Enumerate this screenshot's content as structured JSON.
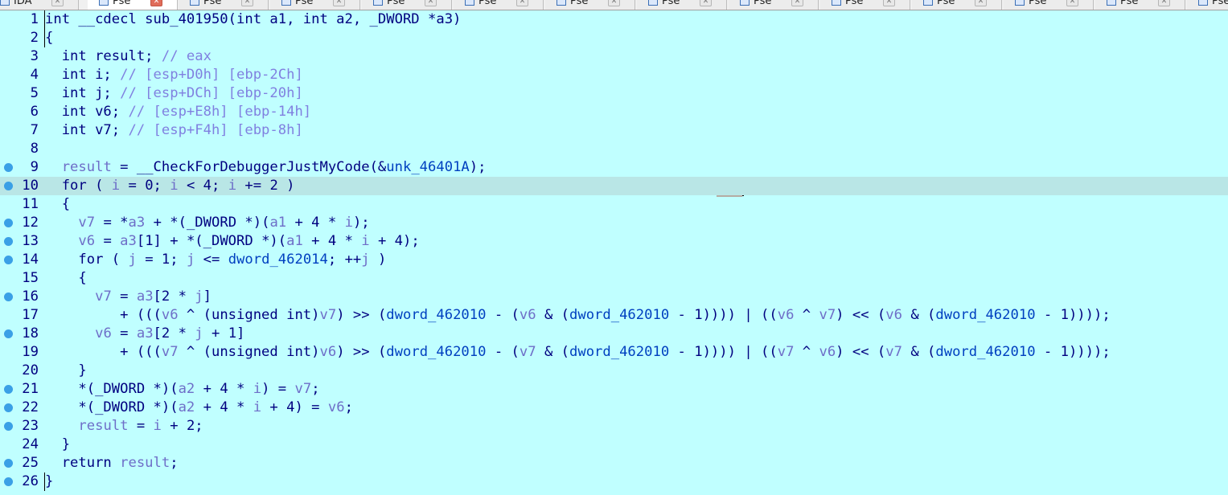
{
  "tabs": [
    {
      "label": "IDA"
    },
    {
      "label": "Pse"
    },
    {
      "label": "Pse"
    },
    {
      "label": "Pse"
    },
    {
      "label": "Pse"
    },
    {
      "label": "Pse"
    },
    {
      "label": "Pse"
    },
    {
      "label": "Pse"
    },
    {
      "label": "Pse"
    },
    {
      "label": "Pse"
    },
    {
      "label": "Pse"
    },
    {
      "label": "Pse"
    },
    {
      "label": "Pse"
    },
    {
      "label": "Pse"
    }
  ],
  "active_tab_index": 1,
  "code": {
    "lines": [
      {
        "n": "1",
        "t": "int __cdecl sub_401950(int a1, int a2, _DWORD *a3)"
      },
      {
        "n": "2",
        "t": "{"
      },
      {
        "n": "3",
        "t": "  int result; // eax"
      },
      {
        "n": "4",
        "t": "  int i; // [esp+D0h] [ebp-2Ch]"
      },
      {
        "n": "5",
        "t": "  int j; // [esp+DCh] [ebp-20h]"
      },
      {
        "n": "6",
        "t": "  int v6; // [esp+E8h] [ebp-14h]"
      },
      {
        "n": "7",
        "t": "  int v7; // [esp+F4h] [ebp-8h]"
      },
      {
        "n": "8",
        "t": ""
      },
      {
        "n": "9",
        "t": "  result = __CheckForDebuggerJustMyCode(&unk_46401A);"
      },
      {
        "n": "10",
        "t": "  for ( i = 0; i < 4; i += 2 )"
      },
      {
        "n": "11",
        "t": "  {"
      },
      {
        "n": "12",
        "t": "    v7 = *a3 + *(_DWORD *)(a1 + 4 * i);"
      },
      {
        "n": "13",
        "t": "    v6 = a3[1] + *(_DWORD *)(a1 + 4 * i + 4);"
      },
      {
        "n": "14",
        "t": "    for ( j = 1; j <= dword_462014; ++j )"
      },
      {
        "n": "15",
        "t": "    {"
      },
      {
        "n": "16",
        "t": "      v7 = a3[2 * j]"
      },
      {
        "n": "17",
        "t": "         + (((v6 ^ (unsigned int)v7) >> (dword_462010 - (v6 & (dword_462010 - 1)))) | ((v6 ^ v7) << (v6 & (dword_462010 - 1))));"
      },
      {
        "n": "18",
        "t": "      v6 = a3[2 * j + 1]"
      },
      {
        "n": "19",
        "t": "         + (((v7 ^ (unsigned int)v6) >> (dword_462010 - (v7 & (dword_462010 - 1)))) | ((v7 ^ v6) << (v7 & (dword_462010 - 1))));"
      },
      {
        "n": "20",
        "t": "    }"
      },
      {
        "n": "21",
        "t": "    *(_DWORD *)(a2 + 4 * i) = v7;"
      },
      {
        "n": "22",
        "t": "    *(_DWORD *)(a2 + 4 * i + 4) = v6;"
      },
      {
        "n": "23",
        "t": "    result = i + 2;"
      },
      {
        "n": "24",
        "t": "  }"
      },
      {
        "n": "25",
        "t": "  return result;"
      },
      {
        "n": "26",
        "t": "}"
      }
    ],
    "breakpoint_lines": [
      "9",
      "10",
      "12",
      "13",
      "14",
      "16",
      "18",
      "21",
      "22",
      "23",
      "25",
      "26"
    ],
    "highlighted_line": "10"
  },
  "colors": {
    "background": "#c0ffff",
    "highlight": "#b9e6e6",
    "text": "#000080",
    "variable": "#6e6ec8",
    "comment": "#8080e0",
    "global": "#0040c0",
    "breakpoint": "#3aa0e6"
  },
  "icons": {
    "tab": "pseudocode-window-icon",
    "close": "close-icon",
    "breakpoint": "breakpoint-dot-icon"
  }
}
